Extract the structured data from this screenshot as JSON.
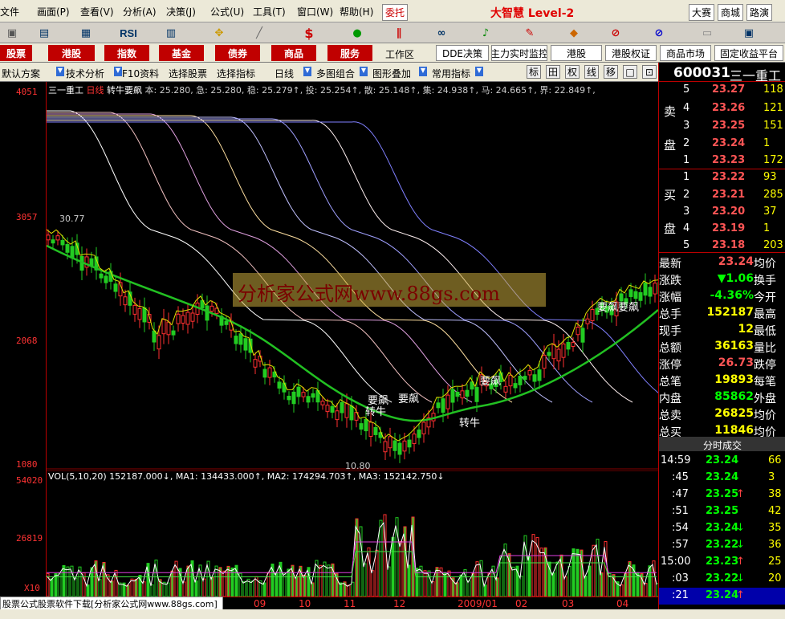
{
  "menu": {
    "items": [
      "文件",
      "画面(P)",
      "查看(V)",
      "分析(A)",
      "决策(J)",
      "公式(U)",
      "工具(T)",
      "窗口(W)",
      "帮助(H)"
    ],
    "entrust": "委托",
    "brand": "大智慧 Level-2",
    "links": [
      "大赛",
      "商城",
      "路演"
    ]
  },
  "toolbar": {
    "icons": [
      "chart-icon",
      "kline-icon",
      "minute-icon",
      "rsi-icon",
      "table-icon",
      "move-icon",
      "ruler-icon",
      "dollar-icon",
      "tick-icon",
      "strategy-icon",
      "binocular-icon",
      "bell-icon",
      "pen-icon",
      "diamond-icon",
      "no-icon",
      "no2-icon",
      "doc-icon",
      "window-icon"
    ],
    "rsi_label": "RSI",
    "dollar_label": "$"
  },
  "nav": {
    "buttons": [
      "股票",
      "港股",
      "指数",
      "基金",
      "债券",
      "商品",
      "服务"
    ],
    "workspace": "工作区",
    "right_buttons": [
      "DDE决策",
      "主力实时监控",
      "港股",
      "港股权证",
      "商品市场",
      "固定收益平台"
    ]
  },
  "tabs": {
    "items": [
      "默认方案",
      "技术分析",
      "F10资料",
      "选择股票",
      "选择指标",
      "日线",
      "多图组合",
      "图形叠加",
      "常用指标"
    ],
    "tools": [
      "标",
      "田",
      "权",
      "线",
      "移",
      "□",
      "⊡"
    ]
  },
  "chart": {
    "stock": "三一重工",
    "period": "日线",
    "indicator": "转牛要飙",
    "title_values": "本: 25.280, 急: 25.280, 稳: 25.279↑, 投: 25.254↑, 散: 25.148↑, 集: 24.938↑, 马: 24.665↑, 界: 22.849↑,",
    "y_ticks": [
      "4051",
      "3057",
      "2068",
      "1080"
    ],
    "annotations": {
      "high_marker": "30.77",
      "low_marker": "10.80",
      "signal_a": "转牛",
      "signal_b": "要飙"
    },
    "watermark": "分析家公式网www.88gs.com",
    "vol_title": "VOL(5,10,20) 152187.000↓, MA1: 134433.000↑, MA2: 174294.703↑, MA3: 152142.750↓",
    "vol_ticks": [
      "54020",
      "26819",
      "X10"
    ],
    "time_labels": [
      "09",
      "10",
      "11",
      "12",
      "2009/01",
      "02",
      "03",
      "04"
    ],
    "footer": "股票公式股票软件下载[分析家公式网www.88gs.com]"
  },
  "quote": {
    "code": "600031",
    "name": "三一重工",
    "sell_label": [
      "卖",
      "盘"
    ],
    "buy_label": [
      "买",
      "盘"
    ],
    "asks": [
      {
        "level": "5",
        "price": "23.27",
        "vol": "118"
      },
      {
        "level": "4",
        "price": "23.26",
        "vol": "121"
      },
      {
        "level": "3",
        "price": "23.25",
        "vol": "151"
      },
      {
        "level": "2",
        "price": "23.24",
        "vol": "1"
      },
      {
        "level": "1",
        "price": "23.23",
        "vol": "172"
      }
    ],
    "bids": [
      {
        "level": "1",
        "price": "23.22",
        "vol": "93"
      },
      {
        "level": "2",
        "price": "23.21",
        "vol": "285"
      },
      {
        "level": "3",
        "price": "23.20",
        "vol": "37"
      },
      {
        "level": "4",
        "price": "23.19",
        "vol": "1"
      },
      {
        "level": "5",
        "price": "23.18",
        "vol": "203"
      }
    ],
    "stats": [
      {
        "k": "最新",
        "v": "23.24",
        "k2": "均价",
        "c": "#ff5555"
      },
      {
        "k": "涨跌",
        "v": "▼1.06",
        "k2": "换手",
        "c": "#00ff00"
      },
      {
        "k": "涨幅",
        "v": "-4.36%",
        "k2": "今开",
        "c": "#00ff00"
      },
      {
        "k": "总手",
        "v": "152187",
        "k2": "最高",
        "c": "#ffff00"
      },
      {
        "k": "现手",
        "v": "12",
        "k2": "最低",
        "c": "#ffff00"
      },
      {
        "k": "总额",
        "v": "36163",
        "k2": "量比",
        "c": "#ffff00"
      },
      {
        "k": "涨停",
        "v": "26.73",
        "k2": "跌停",
        "c": "#ff5555"
      },
      {
        "k": "总笔",
        "v": "19893",
        "k2": "每笔",
        "c": "#ffff00"
      },
      {
        "k": "内盘",
        "v": "85862",
        "k2": "外盘",
        "c": "#00ff00"
      },
      {
        "k": "总卖",
        "v": "26825",
        "k2": "均价",
        "c": "#ffff00"
      },
      {
        "k": "总买",
        "v": "11846",
        "k2": "均价",
        "c": "#ffff00"
      }
    ],
    "ticks_title": "分时成交",
    "ticks": [
      {
        "t": "14:59",
        "p": "23.24",
        "arrow": "",
        "v": "66"
      },
      {
        "t": ":45",
        "p": "23.24",
        "arrow": "",
        "v": "3"
      },
      {
        "t": ":47",
        "p": "23.25",
        "arrow": "↑",
        "v": "38"
      },
      {
        "t": ":51",
        "p": "23.25",
        "arrow": "",
        "v": "42"
      },
      {
        "t": ":54",
        "p": "23.24",
        "arrow": "↓",
        "v": "35"
      },
      {
        "t": ":57",
        "p": "23.22",
        "arrow": "↓",
        "v": "36"
      },
      {
        "t": "15:00",
        "p": "23.23",
        "arrow": "↑",
        "v": "25"
      },
      {
        "t": ":03",
        "p": "23.22",
        "arrow": "↓",
        "v": "20"
      },
      {
        "t": ":21",
        "p": "23.24",
        "arrow": "↑",
        "v": ""
      }
    ]
  }
}
